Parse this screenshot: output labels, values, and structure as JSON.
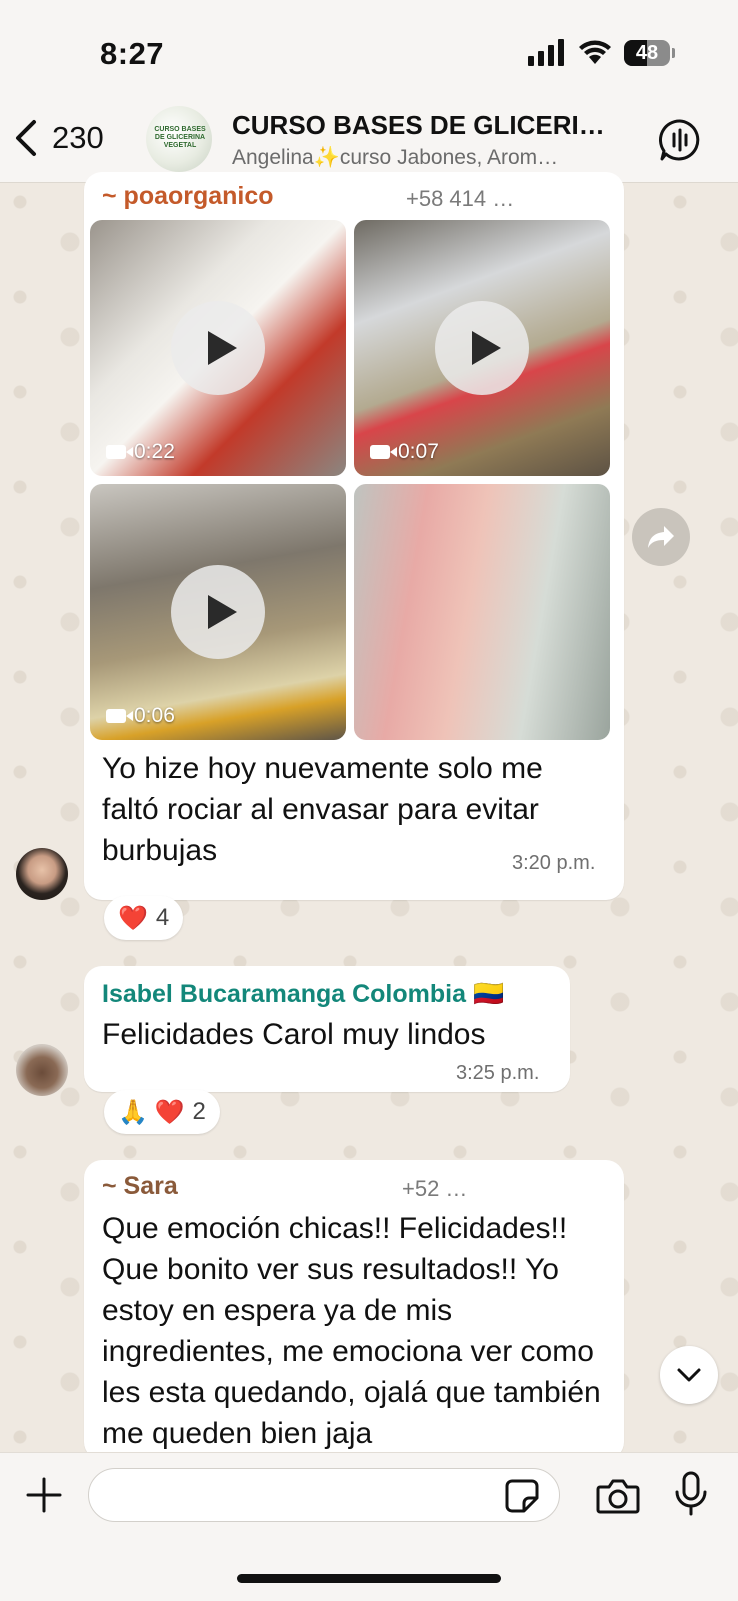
{
  "status_bar": {
    "time": "8:27",
    "battery": "48"
  },
  "header": {
    "back_count": "230",
    "group_name": "CURSO BASES DE GLICERI…",
    "subtitle": "Angelina✨curso Jabones, Arom…",
    "avatar_text": "CURSO BASES DE GLICERINA VEGETAL"
  },
  "messages": [
    {
      "sender": "~ poaorganico",
      "sender_color": "#c45a2a",
      "phone": "+58 414 …",
      "media": [
        {
          "type": "video",
          "duration": "0:22"
        },
        {
          "type": "video",
          "duration": "0:07"
        },
        {
          "type": "video",
          "duration": "0:06"
        },
        {
          "type": "image"
        }
      ],
      "text": "Yo hize hoy nuevamente solo me faltó rociar al envasar para evitar burbujas",
      "time": "3:20 p.m.",
      "reactions": {
        "emojis": "❤️",
        "count": "4"
      }
    },
    {
      "sender": "Isabel Bucaramanga Colombia",
      "sender_color": "#13877a",
      "flag": "🇨🇴",
      "text": "Felicidades Carol muy lindos",
      "time": "3:25 p.m.",
      "reactions": {
        "emojis": "🙏 ❤️",
        "count": "2"
      }
    },
    {
      "sender": "~ Sara",
      "sender_color": "#8a5a3a",
      "phone": "+52 …",
      "text": "Que emoción chicas!! Felicidades!! Que bonito ver sus resultados!! Yo estoy en espera ya de mis ingredientes, me emociona ver como les esta quedando, ojalá que también me queden bien jaja"
    }
  ],
  "input": {
    "placeholder": ""
  }
}
